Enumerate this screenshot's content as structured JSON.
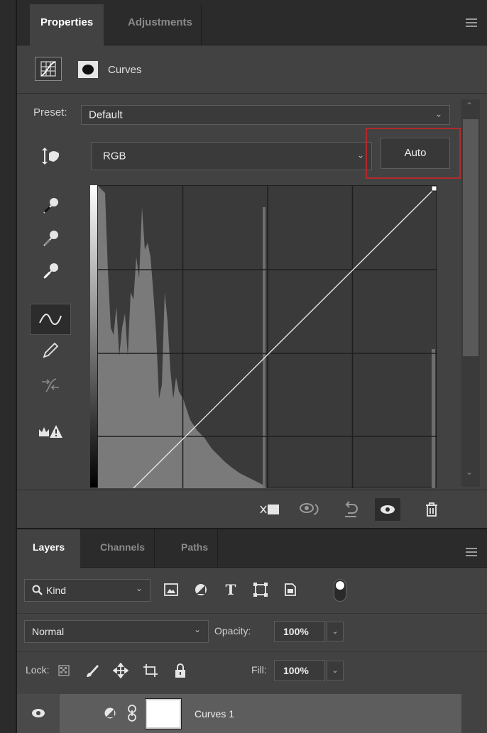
{
  "properties_panel": {
    "tabs": [
      {
        "label": "Properties",
        "active": true
      },
      {
        "label": "Adjustments",
        "active": false
      }
    ],
    "adjustment_title": "Curves",
    "preset_label": "Preset:",
    "preset_value": "Default",
    "channel_value": "RGB",
    "auto_label": "Auto",
    "tools": [
      "target-adjust-icon",
      "black-eyedropper-icon",
      "gray-eyedropper-icon",
      "white-eyedropper-icon",
      "curve-points-icon",
      "pencil-icon",
      "smooth-icon",
      "clipping-warning-icon"
    ],
    "footer_icons": [
      "clip-to-layer-icon",
      "view-previous-icon",
      "reset-icon",
      "visibility-icon",
      "delete-icon"
    ]
  },
  "layers_panel": {
    "tabs": [
      {
        "label": "Layers",
        "active": true
      },
      {
        "label": "Channels",
        "active": false
      },
      {
        "label": "Paths",
        "active": false
      }
    ],
    "filter_kind": "Kind",
    "blend_mode": "Normal",
    "opacity_label": "Opacity:",
    "opacity_value": "100%",
    "lock_label": "Lock:",
    "fill_label": "Fill:",
    "fill_value": "100%",
    "layers": [
      {
        "name": "Curves 1",
        "visible": true
      }
    ]
  },
  "colors": {
    "panel": "#424242",
    "tabbar": "#2b2b2b",
    "highlight": "#b22a2a"
  }
}
